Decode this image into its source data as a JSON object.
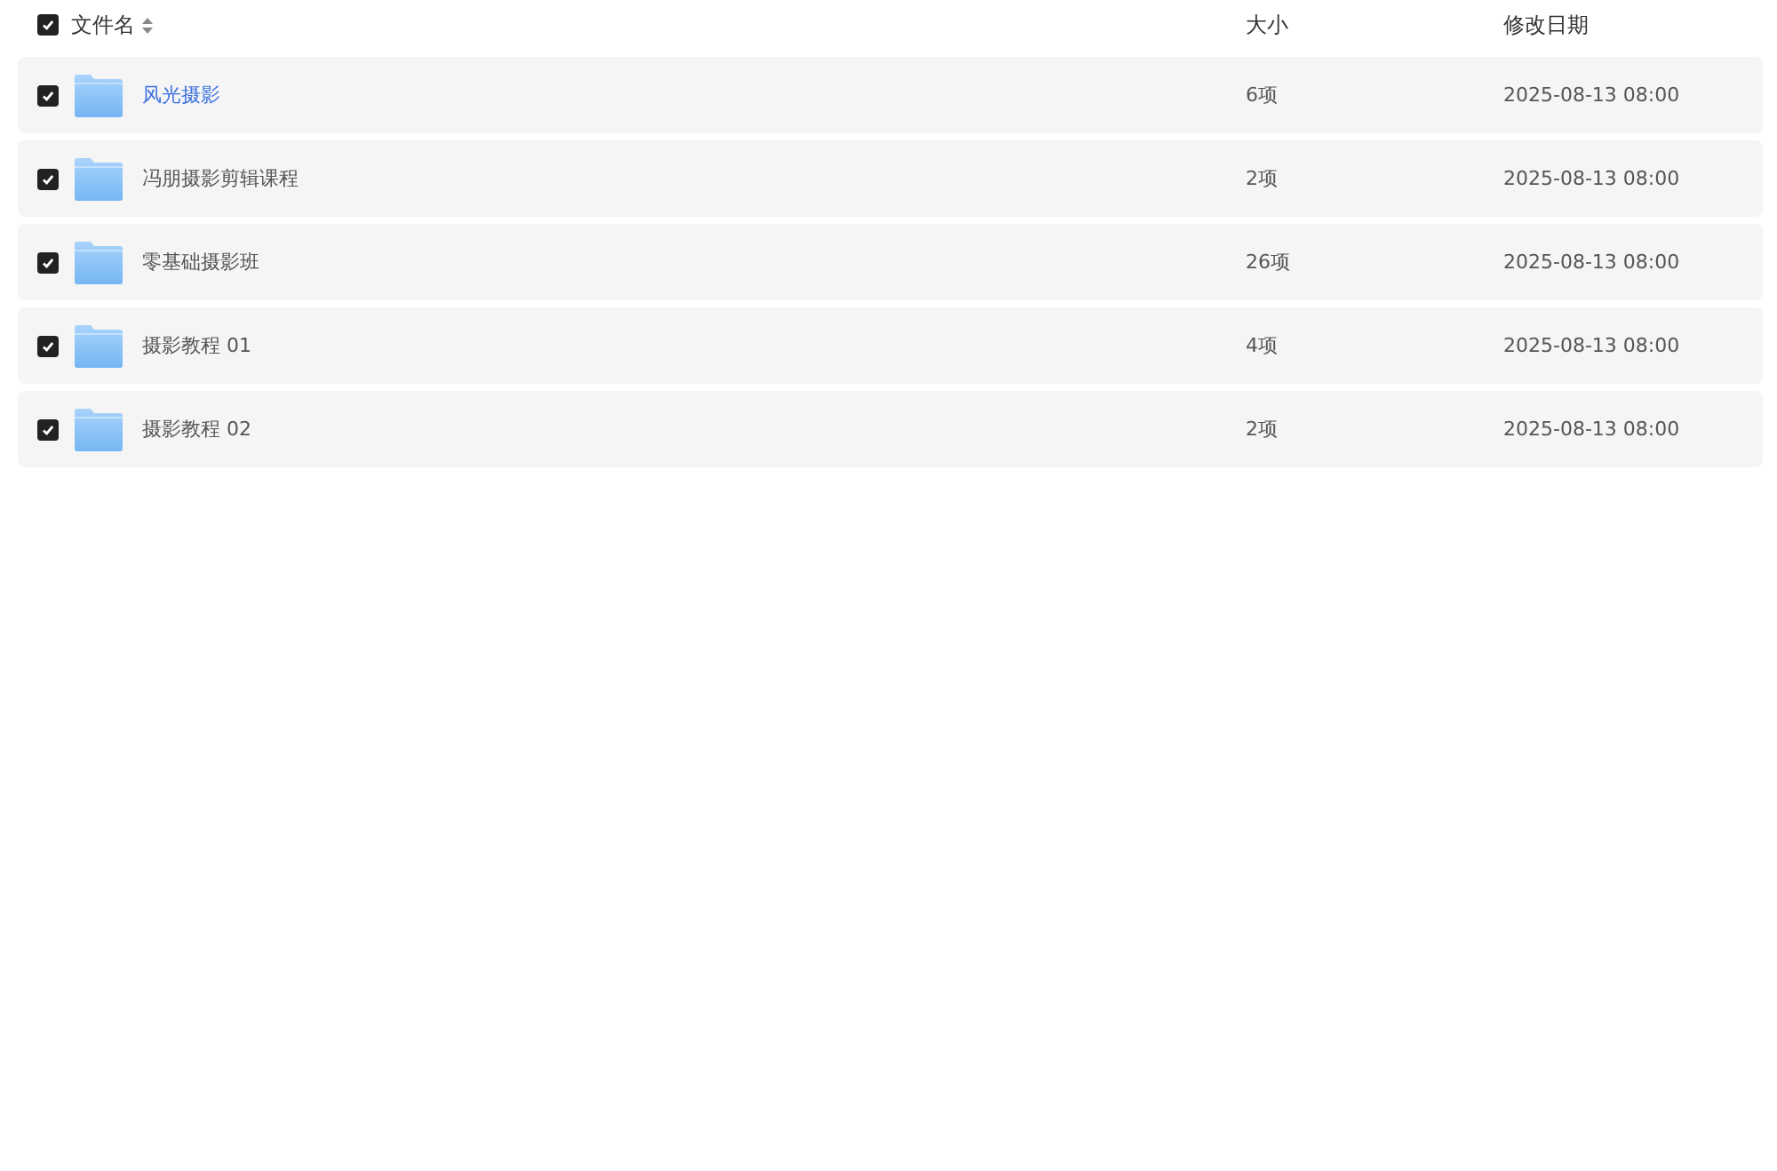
{
  "header": {
    "checked": true,
    "columns": [
      "文件名",
      "大小",
      "修改日期"
    ]
  },
  "rows": [
    {
      "name": "风光摄影",
      "size": "6项",
      "date": "2025-08-13 08:00",
      "checked": true,
      "highlighted": true
    },
    {
      "name": "冯朋摄影剪辑课程",
      "size": "2项",
      "date": "2025-08-13 08:00",
      "checked": true,
      "highlighted": false
    },
    {
      "name": "零基础摄影班",
      "size": "26项",
      "date": "2025-08-13 08:00",
      "checked": true,
      "highlighted": false
    },
    {
      "name": "摄影教程 01",
      "size": "4项",
      "date": "2025-08-13 08:00",
      "checked": true,
      "highlighted": false
    },
    {
      "name": "摄影教程 02",
      "size": "2项",
      "date": "2025-08-13 08:00",
      "checked": true,
      "highlighted": false
    }
  ]
}
